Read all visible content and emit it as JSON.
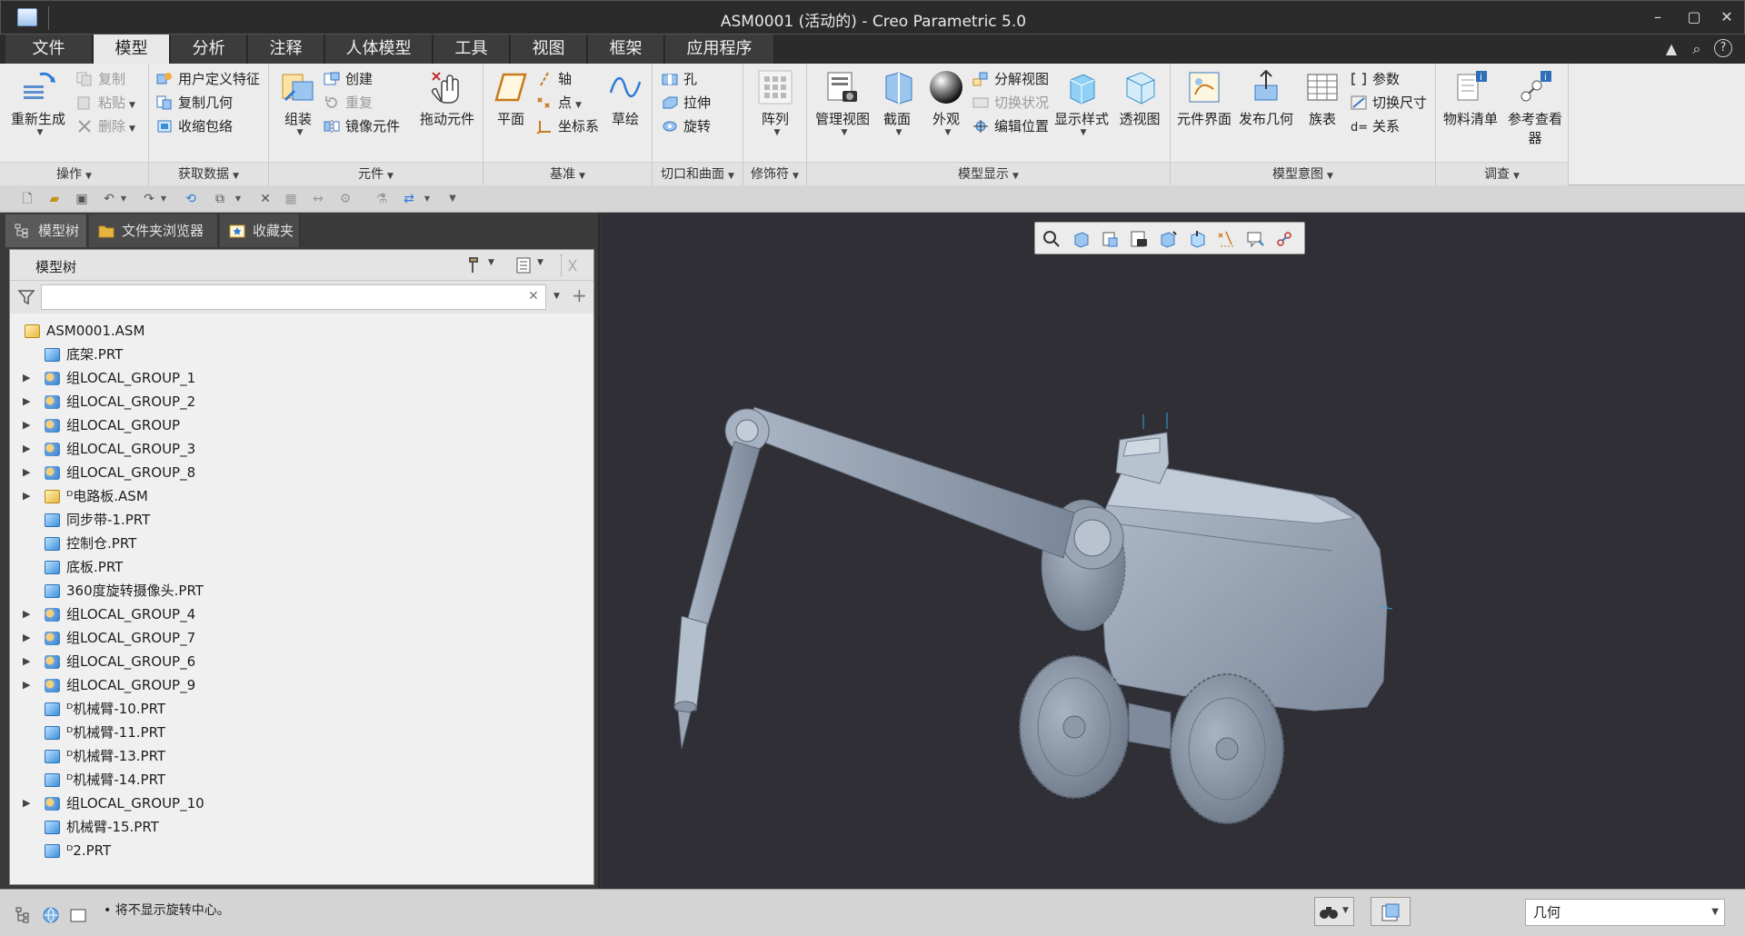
{
  "window": {
    "title": "ASM0001 (活动的) - Creo Parametric 5.0",
    "minimize": "–",
    "maximize": "▢",
    "close": "✕"
  },
  "tabs": [
    "文件",
    "模型",
    "分析",
    "注释",
    "人体模型",
    "工具",
    "视图",
    "框架",
    "应用程序"
  ],
  "active_tab": "模型",
  "ribbon": {
    "regenerate": "重新生成",
    "copy": "复制",
    "paste": "粘贴",
    "delete": "删除",
    "user_feature": "用户定义特征",
    "copy_geometry": "复制几何",
    "shrinkwrap": "收缩包络",
    "assemble": "组装",
    "create": "创建",
    "repeat": "重复",
    "mirror_component": "镜像元件",
    "drag_components": "拖动元件",
    "plane": "平面",
    "axis": "轴",
    "point": "点",
    "csys": "坐标系",
    "sketch": "草绘",
    "hole": "孔",
    "extrude": "拉伸",
    "revolve": "旋转",
    "pattern": "阵列",
    "manage_views": "管理视图",
    "section": "截面",
    "appearance": "外观",
    "exploded_view": "分解视图",
    "toggle_status": "切换状况",
    "edit_position": "编辑位置",
    "display_style": "显示样式",
    "perspective": "透视图",
    "component_interface": "元件界面",
    "publish_geometry": "发布几何",
    "family_table": "族表",
    "parameters": "参数",
    "switch_dimensions": "切换尺寸",
    "relations": "关系",
    "bom": "物料清单",
    "reference_viewer": "参考查看器",
    "groups": {
      "operations": "操作",
      "get_data": "获取数据",
      "component": "元件",
      "datum": "基准",
      "cut_surface": "切口和曲面",
      "modifiers": "修饰符",
      "model_display": "模型显示",
      "model_intent": "模型意图",
      "investigate": "调查"
    }
  },
  "panel": {
    "tabs": [
      "模型树",
      "文件夹浏览器",
      "收藏夹"
    ],
    "tree_title": "模型树",
    "filter_clear": "✕",
    "filter_add": "+"
  },
  "tree": [
    {
      "label": "ASM0001.ASM",
      "icon": "assembly-icon",
      "expandable": false,
      "root": true
    },
    {
      "label": "底架.PRT",
      "icon": "part-icon",
      "expandable": false
    },
    {
      "label": "组LOCAL_GROUP_1",
      "icon": "group-icon",
      "expandable": true
    },
    {
      "label": "组LOCAL_GROUP_2",
      "icon": "group-icon",
      "expandable": true
    },
    {
      "label": "组LOCAL_GROUP",
      "icon": "group-icon",
      "expandable": true
    },
    {
      "label": "组LOCAL_GROUP_3",
      "icon": "group-icon",
      "expandable": true
    },
    {
      "label": "组LOCAL_GROUP_8",
      "icon": "group-icon",
      "expandable": true
    },
    {
      "label": "ᴰ电路板.ASM",
      "icon": "assembly-icon",
      "expandable": true
    },
    {
      "label": "同步带-1.PRT",
      "icon": "part-icon",
      "expandable": false
    },
    {
      "label": "控制仓.PRT",
      "icon": "part-icon",
      "expandable": false
    },
    {
      "label": "底板.PRT",
      "icon": "part-icon",
      "expandable": false
    },
    {
      "label": "360度旋转摄像头.PRT",
      "icon": "part-icon",
      "expandable": false
    },
    {
      "label": "组LOCAL_GROUP_4",
      "icon": "group-icon",
      "expandable": true
    },
    {
      "label": "组LOCAL_GROUP_7",
      "icon": "group-icon",
      "expandable": true
    },
    {
      "label": "组LOCAL_GROUP_6",
      "icon": "group-icon",
      "expandable": true
    },
    {
      "label": "组LOCAL_GROUP_9",
      "icon": "group-icon",
      "expandable": true
    },
    {
      "label": "ᴰ机械臂-10.PRT",
      "icon": "part-icon",
      "expandable": false
    },
    {
      "label": "ᴰ机械臂-11.PRT",
      "icon": "part-icon",
      "expandable": false
    },
    {
      "label": "ᴰ机械臂-13.PRT",
      "icon": "part-icon",
      "expandable": false
    },
    {
      "label": "ᴰ机械臂-14.PRT",
      "icon": "part-icon",
      "expandable": false
    },
    {
      "label": "组LOCAL_GROUP_10",
      "icon": "group-icon",
      "expandable": true
    },
    {
      "label": "机械臂-15.PRT",
      "icon": "part-icon",
      "expandable": false
    },
    {
      "label": "ᴰ2.PRT",
      "icon": "part-icon",
      "expandable": false
    }
  ],
  "status": {
    "message": "• 将不显示旋转中心。",
    "filter_value": "几何"
  },
  "colors": {
    "accent": "#3a8fdb",
    "viewport_bg": "#2f2f35",
    "model": "#9aa6b8"
  }
}
